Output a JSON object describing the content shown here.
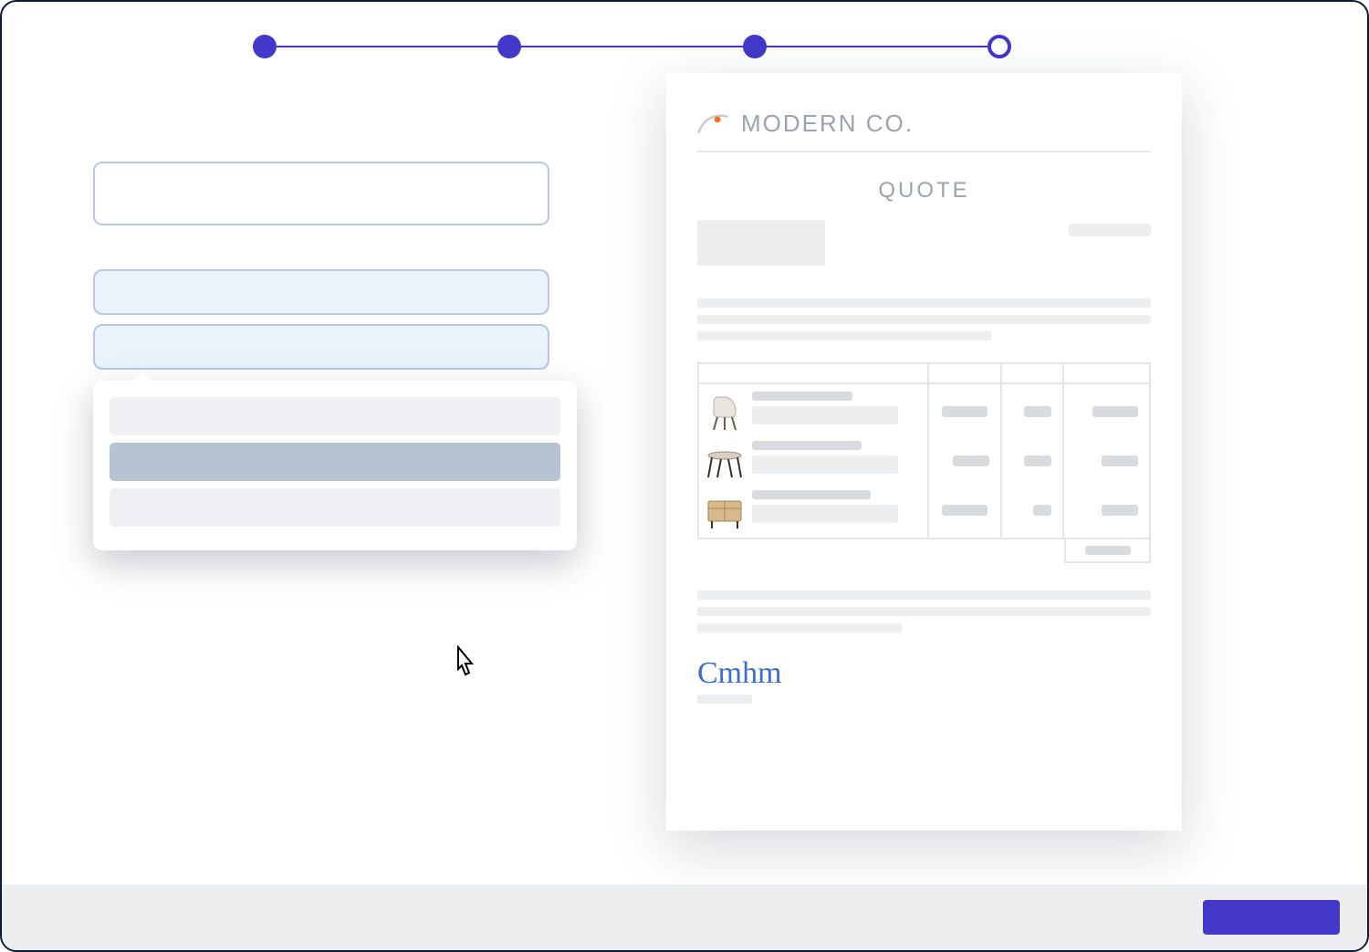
{
  "stepper": {
    "steps": [
      {
        "state": "complete"
      },
      {
        "state": "complete"
      },
      {
        "state": "complete"
      },
      {
        "state": "current"
      }
    ]
  },
  "form": {
    "field1_value": "",
    "field2_value": "",
    "field3_value": "",
    "dropdown": {
      "options": [
        {
          "label": "",
          "hovered": false
        },
        {
          "label": "",
          "hovered": true
        },
        {
          "label": "",
          "hovered": false
        }
      ]
    }
  },
  "document": {
    "company_name": "MODERN CO.",
    "title": "QUOTE",
    "line_items": [
      {
        "product": "chair",
        "thumb": "chair-icon"
      },
      {
        "product": "table",
        "thumb": "table-icon"
      },
      {
        "product": "sideboard",
        "thumb": "sideboard-icon"
      }
    ],
    "signature_text": "Cmhm"
  },
  "footer": {
    "primary_label": ""
  },
  "colors": {
    "accent": "#4338ca",
    "placeholder": "#eceeef",
    "placeholder_dark": "#d9dcde",
    "text_muted": "#9ca3af",
    "logo_accent": "#ff6a13"
  }
}
